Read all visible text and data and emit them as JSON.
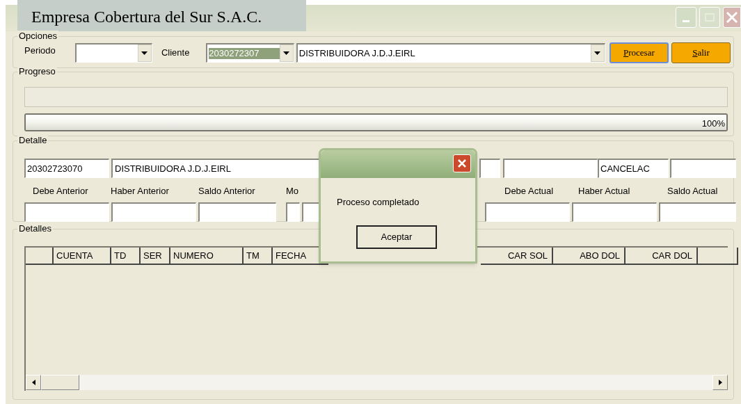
{
  "window": {
    "title": "Empresa Cobertura del Sur S.A.C."
  },
  "opciones": {
    "title": "Opciones",
    "periodo_label": "Periodo",
    "cliente_label": "Cliente",
    "cliente_code": "2030272307",
    "cliente_code_highlighted": true,
    "cliente_name": "DISTRIBUIDORA J.D.J.EIRL",
    "buttons": [
      {
        "label": "Procesar",
        "focused": true
      },
      {
        "label": "Salir",
        "focused": false
      }
    ]
  },
  "progreso": {
    "title": "Progreso",
    "level": 1,
    "reading": "100%"
  },
  "detalle": {
    "title": "Detalle",
    "code": "20302723070",
    "name": "DISTRIBUIDORA J.D.J.EIRL",
    "status": "CANCELAC",
    "left_labels": [
      "Debe Anterior",
      "Haber Anterior",
      "Saldo Anterior",
      "Mo"
    ],
    "right_labels": [
      "Debe Actual",
      "Haber Actual",
      "Saldo Actual"
    ]
  },
  "detalles": {
    "title": "Detalles",
    "left_columns": [
      "CUENTA",
      "TD",
      "SER",
      "NUMERO",
      "TM",
      "FECHA"
    ],
    "right_columns": [
      "CAR SOL",
      "ABO DOL",
      "CAR DOL"
    ]
  },
  "dialog": {
    "message": "Proceso completado",
    "button": "Aceptar"
  }
}
